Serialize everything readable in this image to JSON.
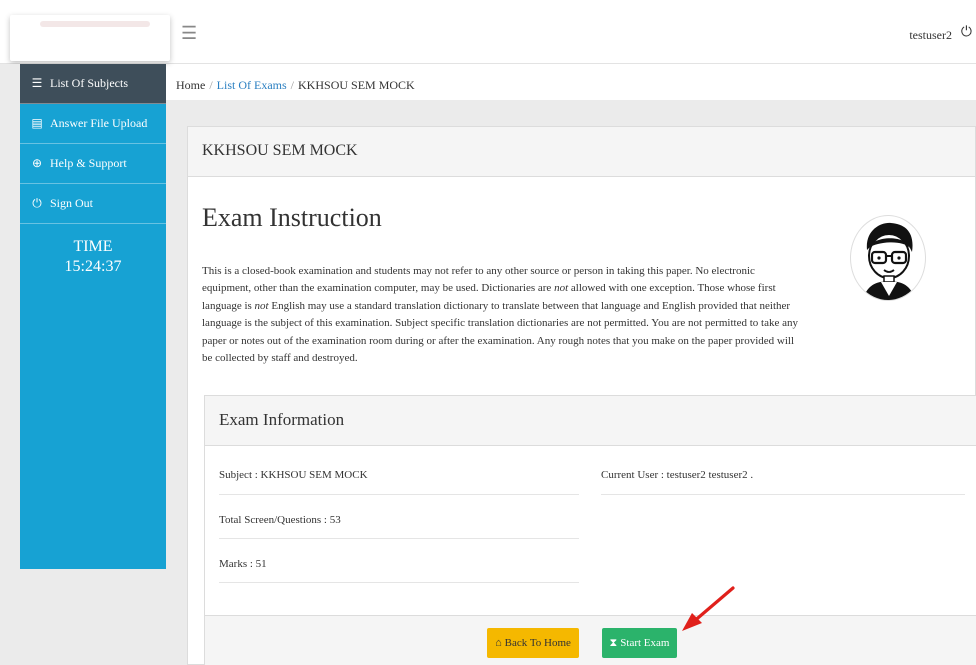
{
  "header": {
    "username": "testuser2",
    "menu_icon": "hamburger-icon",
    "power_icon": "power-icon"
  },
  "sidebar": {
    "items": [
      {
        "label": "List Of Subjects",
        "icon": "list-icon",
        "active": true
      },
      {
        "label": "Answer File Upload",
        "icon": "file-icon",
        "active": false
      },
      {
        "label": "Help & Support",
        "icon": "lifebuoy-icon",
        "active": false
      },
      {
        "label": "Sign Out",
        "icon": "power-icon",
        "active": false
      }
    ],
    "time_label": "TIME",
    "time_value": "15:24:37"
  },
  "breadcrumb": {
    "home": "Home",
    "exams": "List Of Exams",
    "current": "KKHSOU SEM MOCK",
    "sep": "/"
  },
  "card": {
    "title": "KKHSOU SEM MOCK",
    "heading": "Exam Instruction",
    "para_1": "This is a closed-book examination and students may not refer to any other source or person in taking this paper. No electronic equipment, other than the examination computer, may be used. Dictionaries are ",
    "para_not1": "not",
    "para_2": " allowed with one exception. Those whose first language is ",
    "para_not2": "not",
    "para_3": " English may use a standard translation dictionary to translate between that language and English provided that neither language is the subject of this examination. Subject specific translation dictionaries are not permitted. You are not permitted to take any paper or notes out of the examination room during or after the examination. Any rough notes that you make on the paper provided will be collected by staff and destroyed."
  },
  "info": {
    "title": "Exam Information",
    "subject": "Subject : KKHSOU SEM MOCK",
    "current_user": "Current User : testuser2 testuser2 .",
    "questions": "Total Screen/Questions : 53",
    "marks": "Marks : 51"
  },
  "buttons": {
    "back_home": "Back To Home",
    "start_exam": "Start Exam"
  },
  "colors": {
    "sidebar": "#17a2d3",
    "sidebar_active": "#3e4e5a",
    "btn_home": "#f5b800",
    "btn_start": "#2bb36b",
    "arrow": "#e0201b"
  }
}
